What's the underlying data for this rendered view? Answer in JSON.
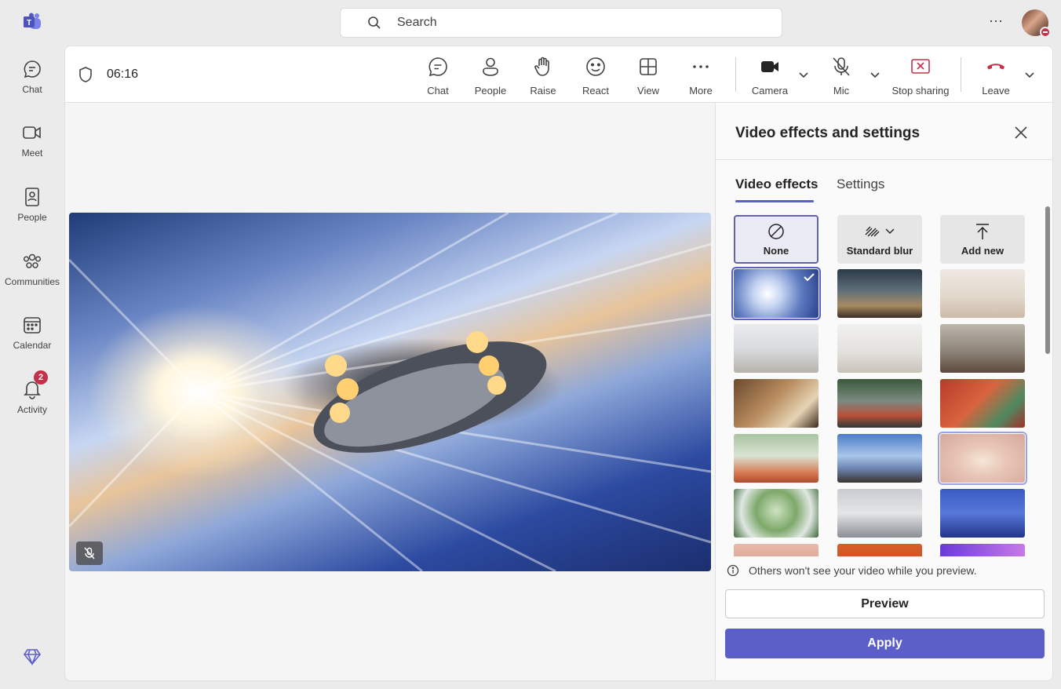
{
  "rail": {
    "items": [
      {
        "label": "Chat",
        "icon": "chat-icon"
      },
      {
        "label": "Meet",
        "icon": "video-camera-icon"
      },
      {
        "label": "People",
        "icon": "contact-card-icon"
      },
      {
        "label": "Communities",
        "icon": "communities-icon"
      },
      {
        "label": "Calendar",
        "icon": "calendar-icon"
      },
      {
        "label": "Activity",
        "icon": "bell-icon",
        "badge": "2"
      }
    ]
  },
  "search": {
    "placeholder": "Search"
  },
  "meeting": {
    "timer": "06:16",
    "toolbar": {
      "chat": "Chat",
      "people": "People",
      "raise": "Raise",
      "react": "React",
      "view": "View",
      "more": "More",
      "camera": "Camera",
      "mic": "Mic",
      "stop_sharing": "Stop sharing",
      "leave": "Leave"
    }
  },
  "panel": {
    "title": "Video effects and settings",
    "tabs": {
      "effects": "Video effects",
      "settings": "Settings"
    },
    "options": {
      "none": "None",
      "blur": "Standard blur",
      "add_new": "Add new"
    },
    "info": "Others won't see your video while you preview.",
    "preview": "Preview",
    "apply": "Apply"
  },
  "colors": {
    "accent": "#5b5fc7",
    "leave": "#c4314b",
    "stop_sharing": "#c4314b"
  }
}
